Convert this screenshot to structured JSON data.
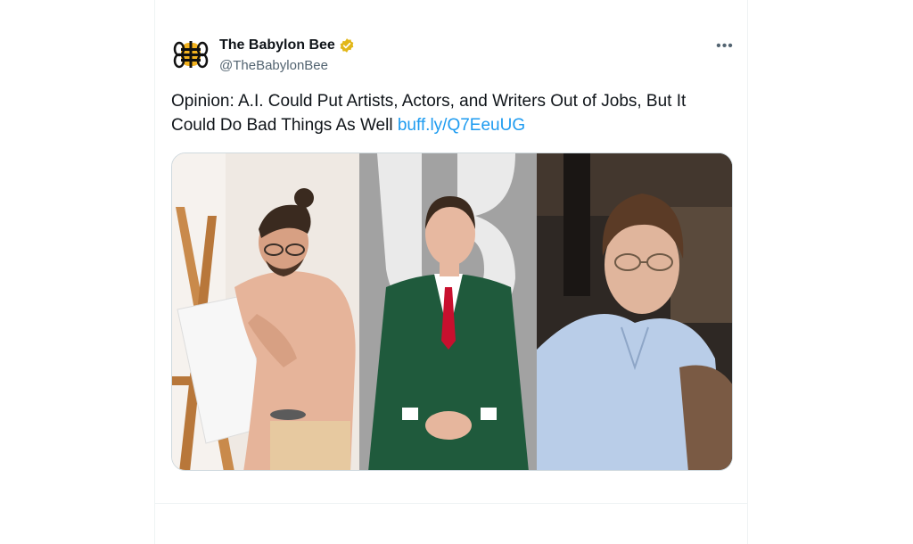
{
  "tweet": {
    "author_name": "The Babylon Bee",
    "author_handle": "@TheBabylonBee",
    "verified_badge_color": "#e2b719",
    "more_icon": "more-horizontal-icon",
    "text": "Opinion: A.I. Could Put Artists, Actors, and Writers Out of Jobs, But It Could Do Bad Things As Well",
    "link_text": "buff.ly/Q7EeuUG",
    "link_color": "#1d9bf0",
    "media": [
      {
        "name": "painter-photo"
      },
      {
        "name": "actor-photo"
      },
      {
        "name": "author-photo"
      }
    ]
  }
}
